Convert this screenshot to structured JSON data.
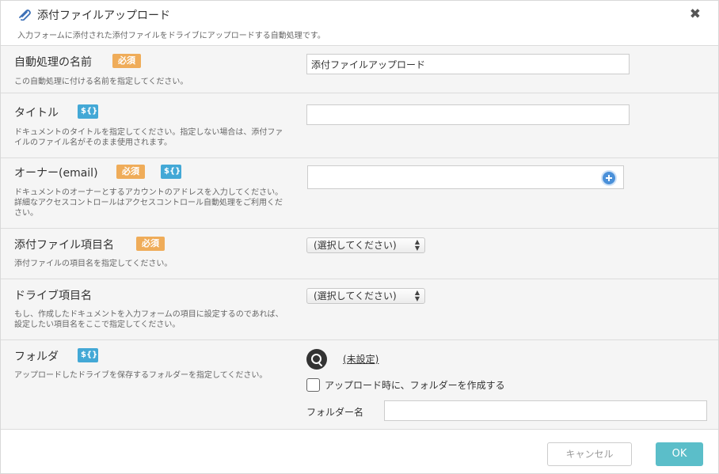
{
  "dialog": {
    "title": "添付ファイルアップロード",
    "subtitle": "入力フォームに添付された添付ファイルをドライブにアップロードする自動処理です。",
    "close_label": "✖"
  },
  "badges": {
    "required": "必須",
    "variable": "${}"
  },
  "fields": {
    "name": {
      "label": "自動処理の名前",
      "description": "この自動処理に付ける名前を指定してください。",
      "value": "添付ファイルアップロード"
    },
    "title": {
      "label": "タイトル",
      "description": "ドキュメントのタイトルを指定してください。指定しない場合は、添付ファイルのファイル名がそのまま使用されます。",
      "value": ""
    },
    "owner": {
      "label": "オーナー(email)",
      "description": "ドキュメントのオーナーとするアカウントのアドレスを入力してください。詳細なアクセスコントロールはアクセスコントロール自動処理をご利用ください。",
      "value": ""
    },
    "attachment_item": {
      "label": "添付ファイル項目名",
      "description": "添付ファイルの項目名を指定してください。",
      "selected": "(選択してください)"
    },
    "drive_item": {
      "label": "ドライブ項目名",
      "description": "もし、作成したドキュメントを入力フォームの項目に設定するのであれば、設定したい項目名をここで指定してください。",
      "selected": "(選択してください)"
    },
    "folder": {
      "label": "フォルダ",
      "description": "アップロードしたドライブを保存するフォルダーを指定してください。",
      "link_text": "(未設定)",
      "create_checkbox_label": "アップロード時に、フォルダーを作成する",
      "create_checked": false,
      "folder_name_label": "フォルダー名",
      "folder_name_value": ""
    }
  },
  "footer": {
    "cancel_label": "キャンセル",
    "ok_label": "OK"
  },
  "colors": {
    "required_badge": "#efac59",
    "variable_badge": "#43a8d6",
    "ok_button": "#5bbec9"
  }
}
